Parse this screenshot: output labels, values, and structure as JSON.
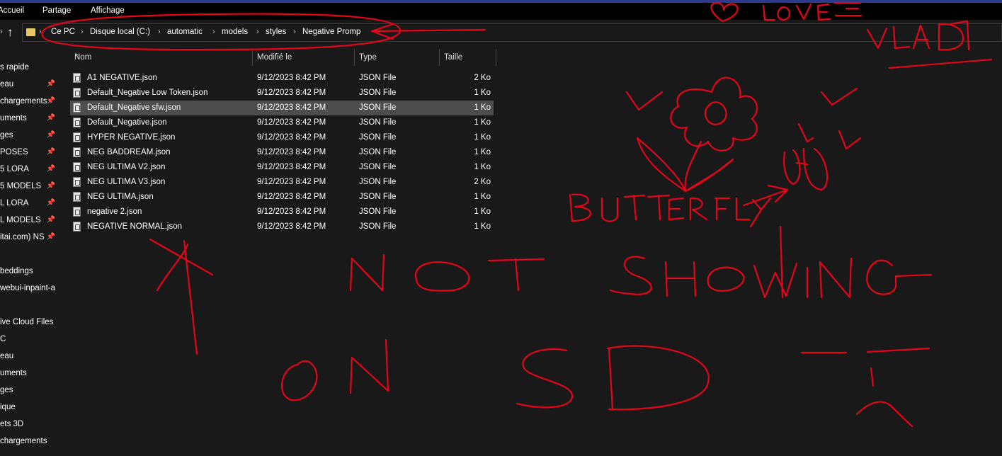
{
  "ribbon": {
    "tabs": [
      "Accueil",
      "Partage",
      "Affichage"
    ]
  },
  "breadcrumb": [
    "Ce PC",
    "Disque local (C:)",
    "automatic",
    "models",
    "styles",
    "Negative Promp"
  ],
  "sidebar": {
    "items": [
      {
        "label": "s rapide",
        "pinned": false
      },
      {
        "label": "eau",
        "pinned": true
      },
      {
        "label": "chargements",
        "pinned": true
      },
      {
        "label": "uments",
        "pinned": true
      },
      {
        "label": "ges",
        "pinned": true
      },
      {
        "label": "POSES",
        "pinned": true
      },
      {
        "label": "5 LORA",
        "pinned": true
      },
      {
        "label": "5 MODELS",
        "pinned": true
      },
      {
        "label": "L LORA",
        "pinned": true
      },
      {
        "label": "L MODELS",
        "pinned": true
      },
      {
        "label": "itai.com) NS",
        "pinned": true
      },
      {
        "label": "",
        "pinned": false
      },
      {
        "label": "beddings",
        "pinned": false
      },
      {
        "label": "webui-inpaint-a",
        "pinned": false
      },
      {
        "label": "",
        "pinned": false
      },
      {
        "label": "ive Cloud Files",
        "pinned": false
      },
      {
        "label": "C",
        "pinned": false
      },
      {
        "label": "eau",
        "pinned": false
      },
      {
        "label": "uments",
        "pinned": false
      },
      {
        "label": "ges",
        "pinned": false
      },
      {
        "label": "ique",
        "pinned": false
      },
      {
        "label": "ets 3D",
        "pinned": false
      },
      {
        "label": "chargements",
        "pinned": false
      }
    ],
    "pin_glyph": "📌"
  },
  "columns": {
    "name": "Nom",
    "modified": "Modifié le",
    "type": "Type",
    "size": "Taille"
  },
  "files": [
    {
      "name": "A1 NEGATIVE.json",
      "modified": "9/12/2023 8:42 PM",
      "type": "JSON File",
      "size": "2 Ko"
    },
    {
      "name": "Default_Negative Low Token.json",
      "modified": "9/12/2023 8:42 PM",
      "type": "JSON File",
      "size": "1 Ko"
    },
    {
      "name": "Default_Negative sfw.json",
      "modified": "9/12/2023 8:42 PM",
      "type": "JSON File",
      "size": "1 Ko",
      "selected": true
    },
    {
      "name": "Default_Negative.json",
      "modified": "9/12/2023 8:42 PM",
      "type": "JSON File",
      "size": "1 Ko"
    },
    {
      "name": "HYPER NEGATIVE.json",
      "modified": "9/12/2023 8:42 PM",
      "type": "JSON File",
      "size": "1 Ko"
    },
    {
      "name": "NEG BADDREAM.json",
      "modified": "9/12/2023 8:42 PM",
      "type": "JSON File",
      "size": "1 Ko"
    },
    {
      "name": "NEG ULTIMA V2.json",
      "modified": "9/12/2023 8:42 PM",
      "type": "JSON File",
      "size": "1 Ko"
    },
    {
      "name": "NEG ULTIMA V3.json",
      "modified": "9/12/2023 8:42 PM",
      "type": "JSON File",
      "size": "2 Ko"
    },
    {
      "name": "NEG ULTIMA.json",
      "modified": "9/12/2023 8:42 PM",
      "type": "JSON File",
      "size": "1 Ko"
    },
    {
      "name": "negative 2.json",
      "modified": "9/12/2023 8:42 PM",
      "type": "JSON File",
      "size": "1 Ko"
    },
    {
      "name": "NEGATIVE NORMAL.json",
      "modified": "9/12/2023 8:42 PM",
      "type": "JSON File",
      "size": "1 Ko"
    }
  ],
  "colors": {
    "background": "#191919",
    "selected_row": "#4d4d4d",
    "annotation_ink": "#e3051a",
    "folder": "#e8c766"
  }
}
